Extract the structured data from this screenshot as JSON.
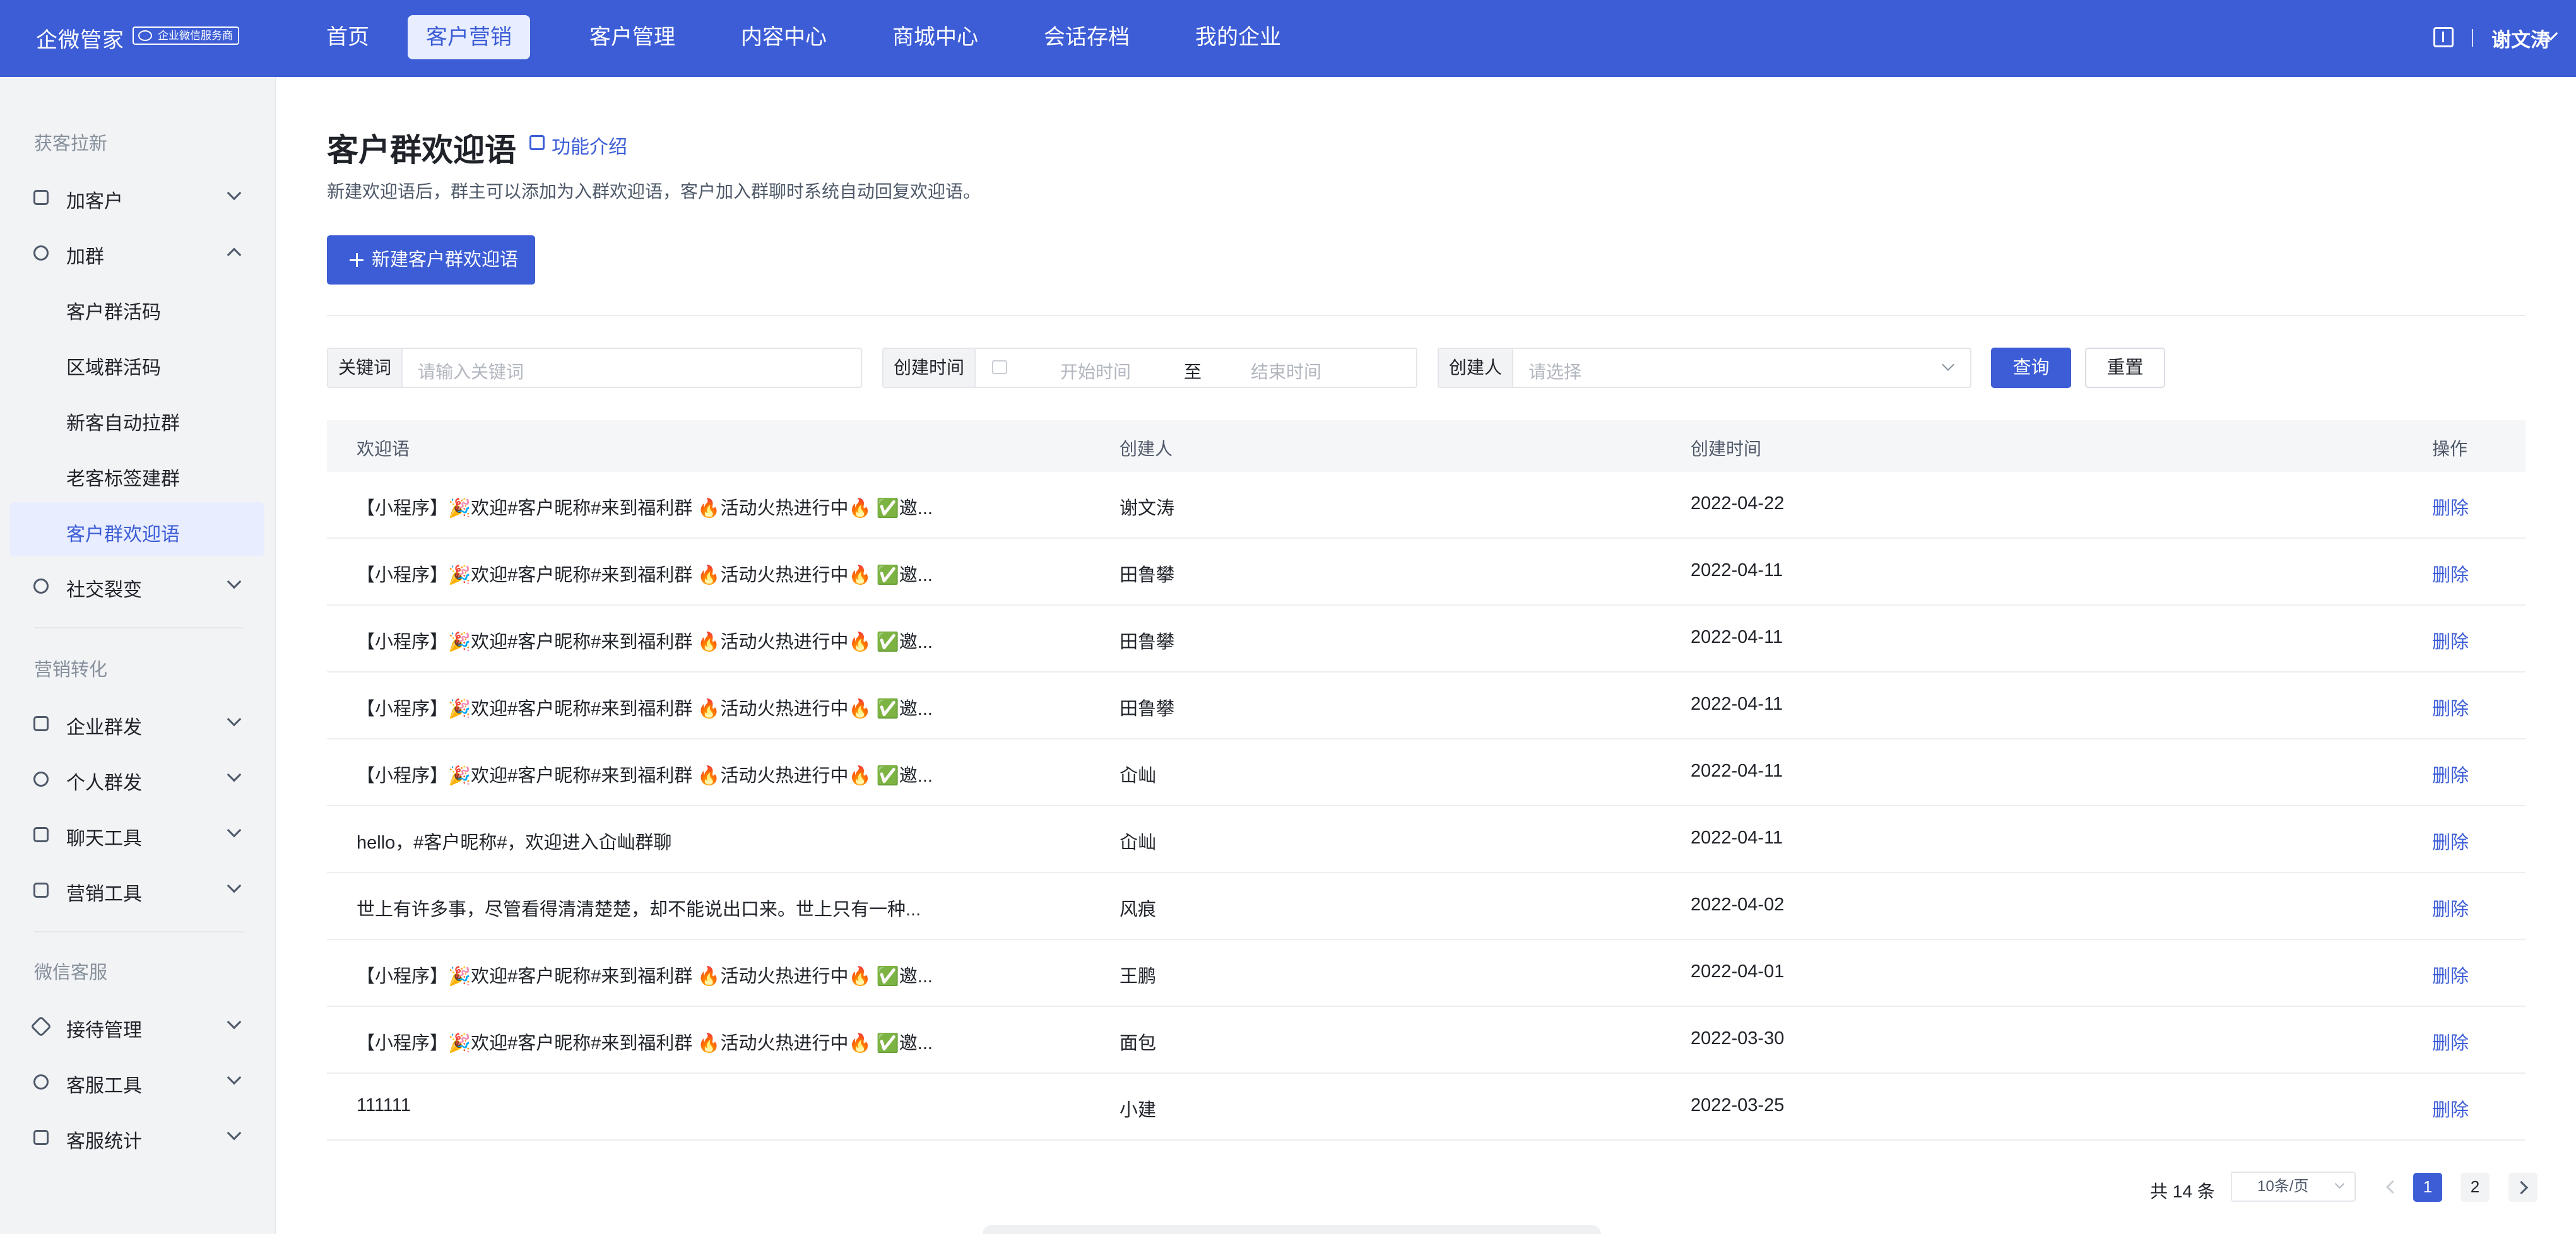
{
  "header": {
    "brand": "企微管家",
    "badge": "企业微信服务商",
    "nav": [
      "首页",
      "客户营销",
      "客户管理",
      "内容中心",
      "商城中心",
      "会话存档",
      "我的企业"
    ],
    "active_nav": "客户营销",
    "username": "谢文涛"
  },
  "sidebar": {
    "sections": [
      {
        "title": "获客拉新"
      },
      {
        "title": "营销转化"
      },
      {
        "title": "微信客服"
      }
    ],
    "items": [
      {
        "label": "加客户"
      },
      {
        "label": "加群"
      },
      {
        "label": "社交裂变"
      },
      {
        "label": "企业群发"
      },
      {
        "label": "个人群发"
      },
      {
        "label": "聊天工具"
      },
      {
        "label": "营销工具"
      },
      {
        "label": "接待管理"
      },
      {
        "label": "客服工具"
      },
      {
        "label": "客服统计"
      }
    ],
    "sub_items": [
      {
        "label": "客户群活码"
      },
      {
        "label": "区域群活码"
      },
      {
        "label": "新客自动拉群"
      },
      {
        "label": "老客标签建群"
      },
      {
        "label": "客户群欢迎语"
      }
    ],
    "active_sub": "客户群欢迎语"
  },
  "main": {
    "title": "客户群欢迎语",
    "intro_link": "功能介绍",
    "description": "新建欢迎语后，群主可以添加为入群欢迎语，客户加入群聊时系统自动回复欢迎语。",
    "new_button": "新建客户群欢迎语",
    "filters": {
      "keyword_label": "关键词",
      "keyword_placeholder": "请输入关键词",
      "time_label": "创建时间",
      "start_placeholder": "开始时间",
      "to": "至",
      "end_placeholder": "结束时间",
      "creator_label": "创建人",
      "creator_placeholder": "请选择",
      "query": "查询",
      "reset": "重置"
    },
    "table": {
      "headers": [
        "欢迎语",
        "创建人",
        "创建时间",
        "操作"
      ],
      "rows": [
        {
          "msg": "【小程序】🎉欢迎#客户昵称#来到福利群 🔥活动火热进行中🔥 ✅邀...",
          "creator": "谢文涛",
          "time": "2022-04-22",
          "op": "删除"
        },
        {
          "msg": "【小程序】🎉欢迎#客户昵称#来到福利群 🔥活动火热进行中🔥 ✅邀...",
          "creator": "田鲁攀",
          "time": "2022-04-11",
          "op": "删除"
        },
        {
          "msg": "【小程序】🎉欢迎#客户昵称#来到福利群 🔥活动火热进行中🔥 ✅邀...",
          "creator": "田鲁攀",
          "time": "2022-04-11",
          "op": "删除"
        },
        {
          "msg": "【小程序】🎉欢迎#客户昵称#来到福利群 🔥活动火热进行中🔥 ✅邀...",
          "creator": "田鲁攀",
          "time": "2022-04-11",
          "op": "删除"
        },
        {
          "msg": "【小程序】🎉欢迎#客户昵称#来到福利群 🔥活动火热进行中🔥 ✅邀...",
          "creator": "屳屾",
          "time": "2022-04-11",
          "op": "删除"
        },
        {
          "msg": "hello，#客户昵称#，欢迎进入屳屾群聊",
          "creator": "屳屾",
          "time": "2022-04-11",
          "op": "删除"
        },
        {
          "msg": "世上有许多事，尽管看得清清楚楚，却不能说出口来。世上只有一种...",
          "creator": "风痕",
          "time": "2022-04-02",
          "op": "删除"
        },
        {
          "msg": "【小程序】🎉欢迎#客户昵称#来到福利群 🔥活动火热进行中🔥 ✅邀...",
          "creator": "王鹏",
          "time": "2022-04-01",
          "op": "删除"
        },
        {
          "msg": "【小程序】🎉欢迎#客户昵称#来到福利群 🔥活动火热进行中🔥 ✅邀...",
          "creator": "面包",
          "time": "2022-03-30",
          "op": "删除"
        },
        {
          "msg": "111111",
          "creator": "小建",
          "time": "2022-03-25",
          "op": "删除"
        }
      ]
    },
    "pagination": {
      "total": "共 14 条",
      "page_size": "10条/页",
      "pages": [
        "1",
        "2"
      ],
      "current": "1"
    }
  }
}
